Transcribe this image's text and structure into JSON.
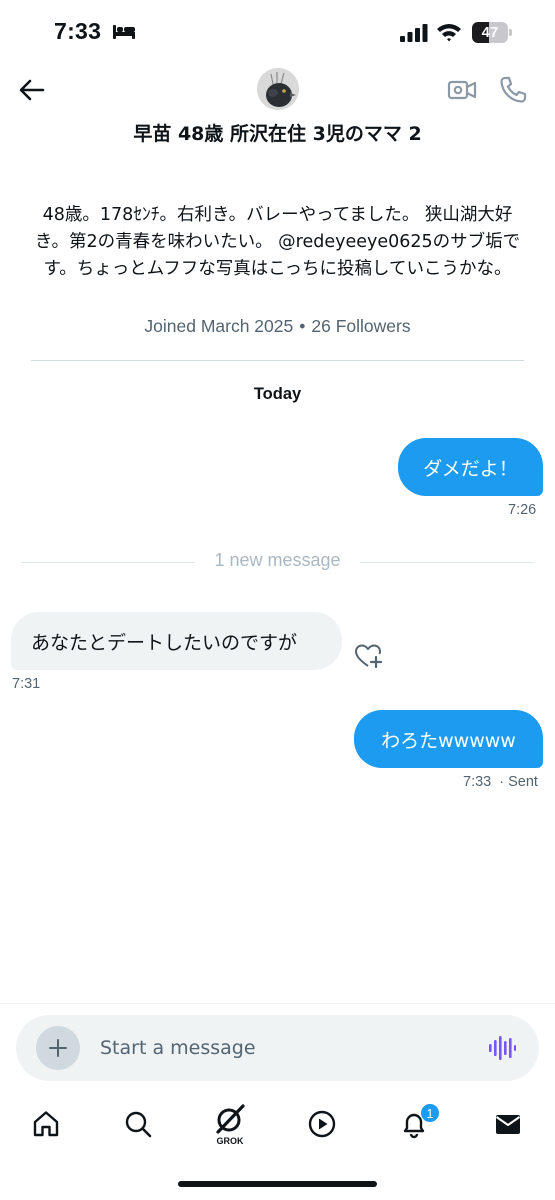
{
  "status_bar": {
    "time": "7:33",
    "battery_level": "47",
    "battery_percent": 47
  },
  "header": {
    "profile_name": "早苗 48歳 所沢在住 3児のママ 2",
    "icons": {
      "back": "arrow-left-icon",
      "video": "video-call-icon",
      "call": "phone-icon"
    }
  },
  "profile": {
    "bio": "48歳。178ｾﾝﾁ。右利き。バレーやってました。 狭山湖大好き。第2の青春を味わいたい。 @redeyeeye0625のサブ垢です。ちょっとムフフな写真はこっちに投稿していこうかな。",
    "joined": "Joined March 2025",
    "followers": "26 Followers"
  },
  "conversation": {
    "date_label": "Today",
    "new_message_label": "1 new message",
    "messages": [
      {
        "direction": "out",
        "text": "ダメだよ！",
        "time": "7:26"
      },
      {
        "direction": "in",
        "text": "あなたとデートしたいのですが",
        "time": "7:31"
      },
      {
        "direction": "out",
        "text": "わろたwwwww",
        "time": "7:33",
        "status": "· Sent"
      }
    ]
  },
  "composer": {
    "placeholder": "Start a message"
  },
  "bottom_nav": {
    "items": [
      "home-icon",
      "search-icon",
      "grok-icon",
      "play-icon",
      "bell-icon",
      "mail-icon"
    ],
    "grok_label": "GROK",
    "notification_count": "1"
  },
  "colors": {
    "accent": "#1d9bf0",
    "bubble_in": "#eff3f4",
    "muted_text": "#536471",
    "voice_icon": "#7856ff"
  }
}
